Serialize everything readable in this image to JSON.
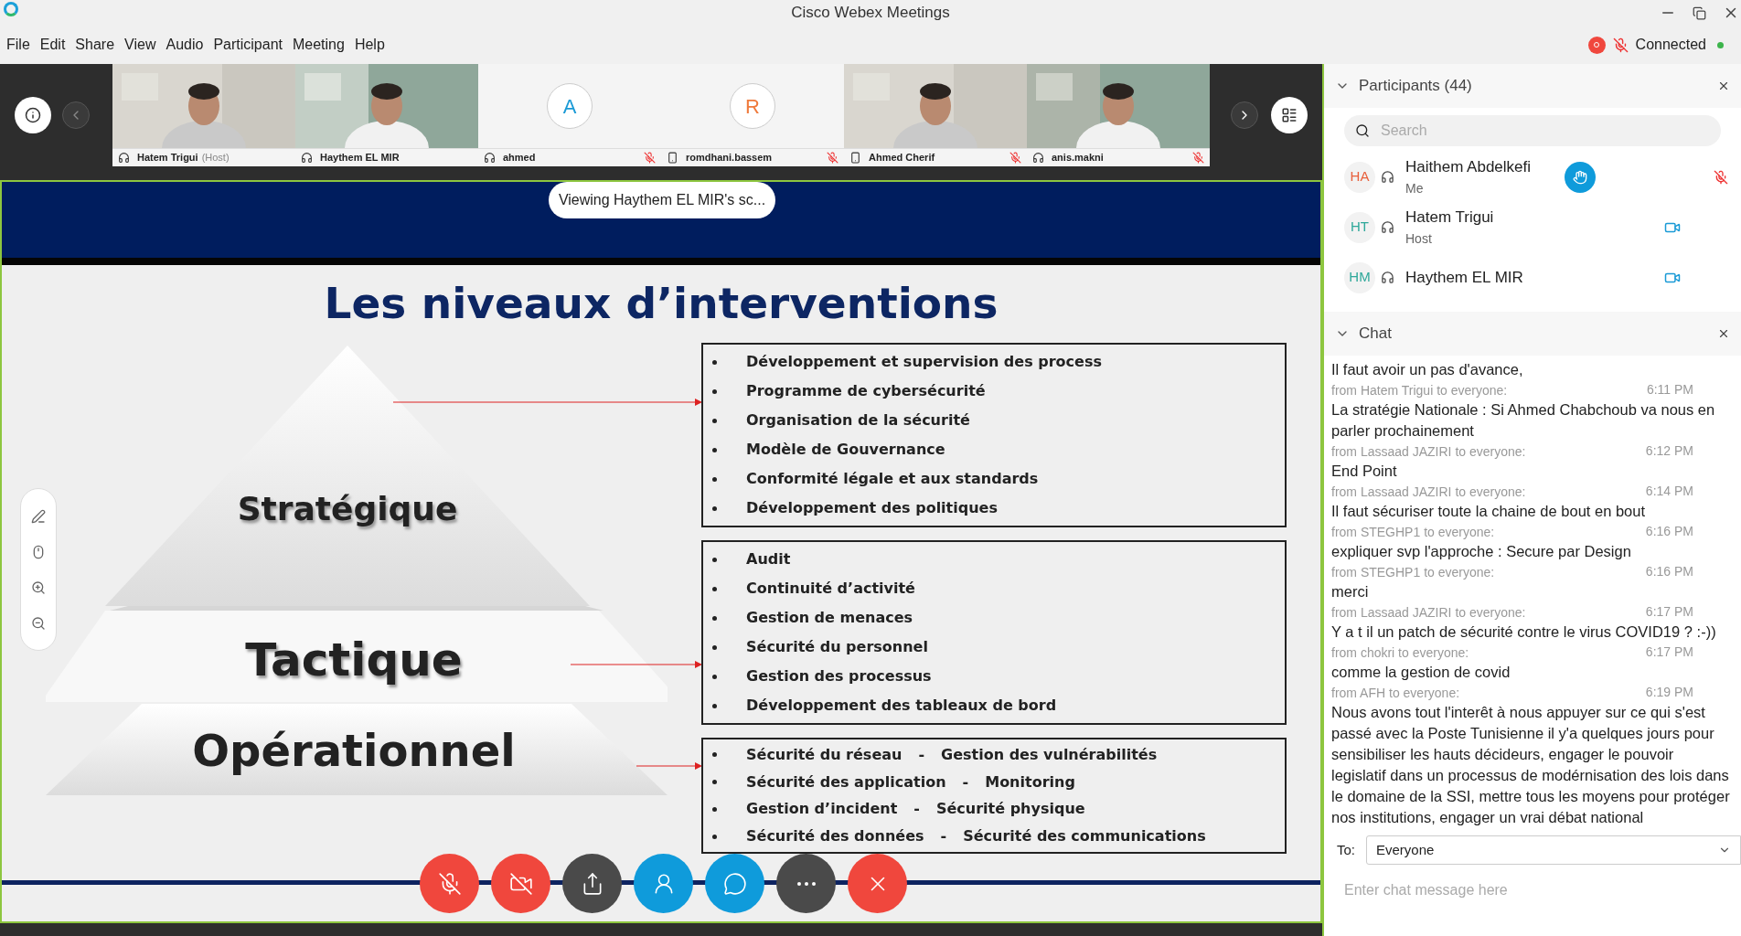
{
  "window": {
    "title": "Cisco Webex Meetings"
  },
  "menu": [
    "File",
    "Edit",
    "Share",
    "View",
    "Audio",
    "Participant",
    "Meeting",
    "Help"
  ],
  "status": {
    "recording": true,
    "muted": true,
    "label": "Connected"
  },
  "videos": [
    {
      "kind": "video",
      "name": "Hatem Trigui",
      "tag": "(Host)",
      "on_phone": false,
      "muted": false
    },
    {
      "kind": "video",
      "name": "Haythem EL MIR",
      "on_phone": false,
      "muted": false
    },
    {
      "kind": "avatar",
      "letter": "A",
      "color": "#1a9ad6",
      "name": "ahmed",
      "on_phone": false,
      "muted": true
    },
    {
      "kind": "avatar",
      "letter": "R",
      "color": "#ef7a3c",
      "name": "romdhani.bassem",
      "on_phone": true,
      "muted": true
    },
    {
      "kind": "video",
      "name": "Ahmed Cherif",
      "on_phone": true,
      "muted": true
    },
    {
      "kind": "video",
      "name": "anis.makni",
      "on_phone": false,
      "muted": true
    }
  ],
  "banner": "Viewing Haythem EL MIR's sc...",
  "slide": {
    "title": "Les niveaux d’interventions",
    "levels": [
      "Stratégique",
      "Tactique",
      "Opérationnel"
    ],
    "boxes": [
      {
        "kind": "list",
        "items": [
          "Développement et supervision des process",
          "Programme de cybersécurité",
          "Organisation de la sécurité",
          "Modèle de Gouvernance",
          "Conformité légale et aux standards",
          "Développement des politiques"
        ]
      },
      {
        "kind": "list",
        "items": [
          "Audit",
          "Continuité d’activité",
          "Gestion de menaces",
          "Sécurité du personnel",
          "Gestion des processus",
          "Développement des tableaux de bord"
        ]
      },
      {
        "kind": "pairs",
        "items": [
          {
            "left": "Sécurité du réseau",
            "dash": "-",
            "right": "Gestion des vulnérabilités"
          },
          {
            "left": "Sécurité des application",
            "dash": "-",
            "right": "Monitoring"
          },
          {
            "left": "Gestion d’incident",
            "dash": "-",
            "right": "Sécurité physique"
          },
          {
            "left": "Sécurité des données",
            "dash": "-",
            "right": "Sécurité des communications"
          }
        ]
      }
    ]
  },
  "controls": [
    {
      "kind": "mute"
    },
    {
      "kind": "video"
    },
    {
      "kind": "share"
    },
    {
      "kind": "participants"
    },
    {
      "kind": "chat"
    },
    {
      "kind": "more"
    },
    {
      "kind": "leave"
    }
  ],
  "participants": {
    "title": "Participants (44)",
    "search_placeholder": "Search",
    "items": [
      {
        "initials": "HA",
        "color": "#e8603c",
        "name": "Haithem Abdelkefi",
        "role": "Me",
        "hand_raised": true,
        "muted": true,
        "video": false
      },
      {
        "initials": "HT",
        "color": "#2fa89a",
        "name": "Hatem Trigui",
        "role": "Host",
        "hand_raised": false,
        "muted": false,
        "video": true
      },
      {
        "initials": "HM",
        "color": "#2fa89a",
        "name": "Haythem EL MIR",
        "hand_raised": false,
        "muted": false,
        "video": true
      }
    ]
  },
  "chat": {
    "title": "Chat",
    "messages": [
      {
        "text": "Il faut avoir un pas d'avance,"
      },
      {
        "from": "from Hatem Trigui to everyone:",
        "time": "6:11 PM",
        "text": "La stratégie Nationale : Si Ahmed Chabchoub va nous en parler prochainement"
      },
      {
        "from": "from Lassaad JAZIRI to everyone:",
        "time": "6:12 PM",
        "text": "End Point"
      },
      {
        "from": "from Lassaad JAZIRI to everyone:",
        "time": "6:14 PM",
        "text": "Il faut sécuriser toute la chaine de bout en bout"
      },
      {
        "from": "from STEGHP1 to everyone:",
        "time": "6:16 PM",
        "text": "expliquer svp l'approche :  Secure par Design"
      },
      {
        "from": "from STEGHP1 to everyone:",
        "time": "6:16 PM",
        "text": "merci"
      },
      {
        "from": "from Lassaad JAZIRI to everyone:",
        "time": "6:17 PM",
        "text": "Y a t il un patch de sécurité contre le virus COVID19 ? :-))"
      },
      {
        "from": "from chokri to everyone:",
        "time": "6:17 PM",
        "text": "comme  la gestion de covid"
      },
      {
        "from": "from AFH to everyone:",
        "time": "6:19 PM",
        "text": "Nous avons tout l'interêt à nous appuyer sur ce qui s'est passé avec la Poste Tunisienne il y'a quelques jours pour sensibiliser les hauts décideurs, engager le pouvoir legislatif dans un processus de modérnisation des lois dans le domaine de la SSI, mettre tous les moyens pour protéger nos institutions, engager un vrai débat national"
      }
    ],
    "to_label": "To:",
    "to_value": "Everyone",
    "input_placeholder": "Enter chat message here"
  }
}
